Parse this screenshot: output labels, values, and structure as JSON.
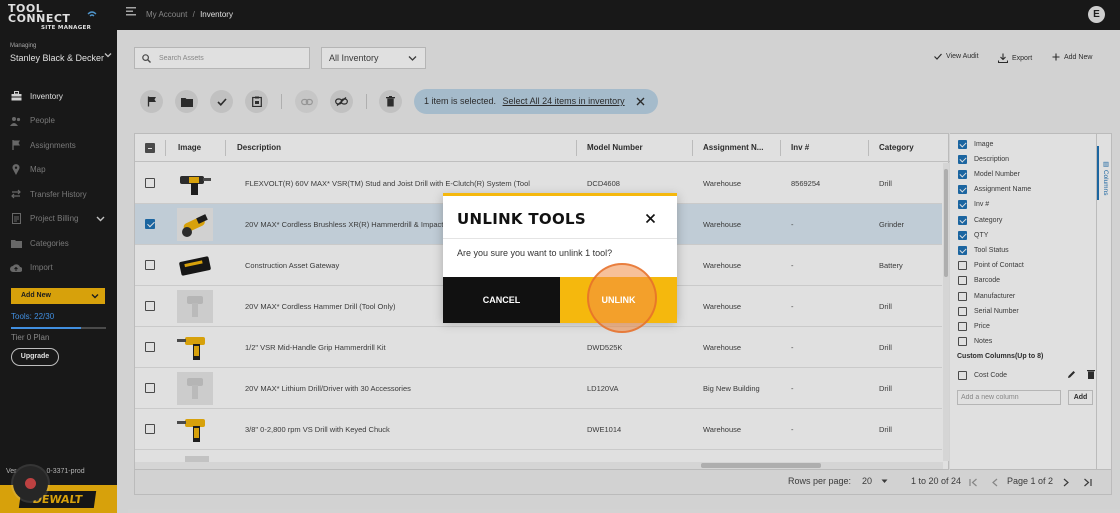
{
  "app": {
    "logo_line1": "TOOL",
    "logo_line2": "CONNECT",
    "logo_line3": "SITE MANAGER",
    "user_initial": "E"
  },
  "breadcrumb": {
    "parent": "My Account",
    "separator": "/",
    "current": "Inventory"
  },
  "sidebar": {
    "managing_label": "Managing",
    "company": "Stanley Black & Decker",
    "items": [
      {
        "label": "Inventory",
        "icon": "toolbox-icon",
        "active": true
      },
      {
        "label": "People",
        "icon": "people-icon"
      },
      {
        "label": "Assignments",
        "icon": "flag-icon"
      },
      {
        "label": "Map",
        "icon": "map-pin-icon"
      },
      {
        "label": "Transfer History",
        "icon": "transfer-icon"
      },
      {
        "label": "Project Billing",
        "icon": "document-icon",
        "has_chevron": true
      },
      {
        "label": "Categories",
        "icon": "folder-icon"
      },
      {
        "label": "Import",
        "icon": "cloud-upload-icon"
      }
    ],
    "add_new": "Add New",
    "tools_count": "Tools: 22/30",
    "tools_fraction": 0.733,
    "tier": "Tier 0 Plan",
    "upgrade": "Upgrade",
    "version_prefix": "Ver",
    "version_suffix": "0-3371-prod",
    "brand": "DEWALT"
  },
  "toolbar": {
    "search_placeholder": "Search Assets",
    "inventory_filter": "All Inventory",
    "view_audit": "View Audit",
    "export": "Export",
    "add_new": "Add New",
    "selection_text": "1 item is selected.",
    "select_all_link": "Select All 24 items in inventory"
  },
  "table": {
    "headers": [
      "Image",
      "Description",
      "Model Number",
      "Assignment N...",
      "Inv #",
      "Category"
    ],
    "rows": [
      {
        "description": "FLEXVOLT(R) 60V MAX* VSR(TM) Stud and Joist Drill with E-Clutch(R) System (Tool",
        "model": "DCD4608",
        "assignment": "Warehouse",
        "inv": "8569254",
        "category": "Drill",
        "selected": false
      },
      {
        "description": "20V MAX* Cordless Brushless XR(R) Hammerdrill & Impact",
        "model": "",
        "assignment": "Warehouse",
        "inv": "-",
        "category": "Grinder",
        "selected": true
      },
      {
        "description": "Construction Asset Gateway",
        "model": "",
        "assignment": "Warehouse",
        "inv": "-",
        "category": "Battery",
        "selected": false
      },
      {
        "description": "20V MAX* Cordless Hammer Drill (Tool Only)",
        "model": "",
        "assignment": "Warehouse",
        "inv": "-",
        "category": "Drill",
        "selected": false
      },
      {
        "description": "1/2\" VSR Mid-Handle Grip Hammerdrill Kit",
        "model": "DWD525K",
        "assignment": "Warehouse",
        "inv": "-",
        "category": "Drill",
        "selected": false
      },
      {
        "description": "20V MAX* Lithium Drill/Driver with 30 Accessories",
        "model": "LD120VA",
        "assignment": "Big New Building",
        "inv": "-",
        "category": "Drill",
        "selected": false
      },
      {
        "description": "3/8\" 0-2,800 rpm VS Drill with Keyed Chuck",
        "model": "DWE1014",
        "assignment": "Warehouse",
        "inv": "-",
        "category": "Drill",
        "selected": false
      }
    ]
  },
  "columns_panel": {
    "tab_label": "Columns",
    "items": [
      {
        "label": "Image",
        "checked": true
      },
      {
        "label": "Description",
        "checked": true
      },
      {
        "label": "Model Number",
        "checked": true
      },
      {
        "label": "Assignment Name",
        "checked": true
      },
      {
        "label": "Inv #",
        "checked": true
      },
      {
        "label": "Category",
        "checked": true
      },
      {
        "label": "QTY",
        "checked": true
      },
      {
        "label": "Tool Status",
        "checked": true
      },
      {
        "label": "Point of Contact",
        "checked": false
      },
      {
        "label": "Barcode",
        "checked": false
      },
      {
        "label": "Manufacturer",
        "checked": false
      },
      {
        "label": "Serial Number",
        "checked": false
      },
      {
        "label": "Price",
        "checked": false
      },
      {
        "label": "Notes",
        "checked": false
      }
    ],
    "custom_heading": "Custom Columns(Up to 8)",
    "custom_item": "Cost Code",
    "new_column_placeholder": "Add a new column",
    "add_button": "Add"
  },
  "pagination": {
    "rows_per_page_label": "Rows per page:",
    "rows_per_page": "20",
    "range": "1 to 20 of 24",
    "page": "Page 1 of 2"
  },
  "modal": {
    "title": "UNLINK TOOLS",
    "message": "Are you sure you want to unlink 1 tool?",
    "cancel": "CANCEL",
    "confirm": "UNLINK"
  },
  "colors": {
    "accent": "#f5b80d",
    "link": "#1f73b7",
    "dark": "#1c1c1c"
  }
}
